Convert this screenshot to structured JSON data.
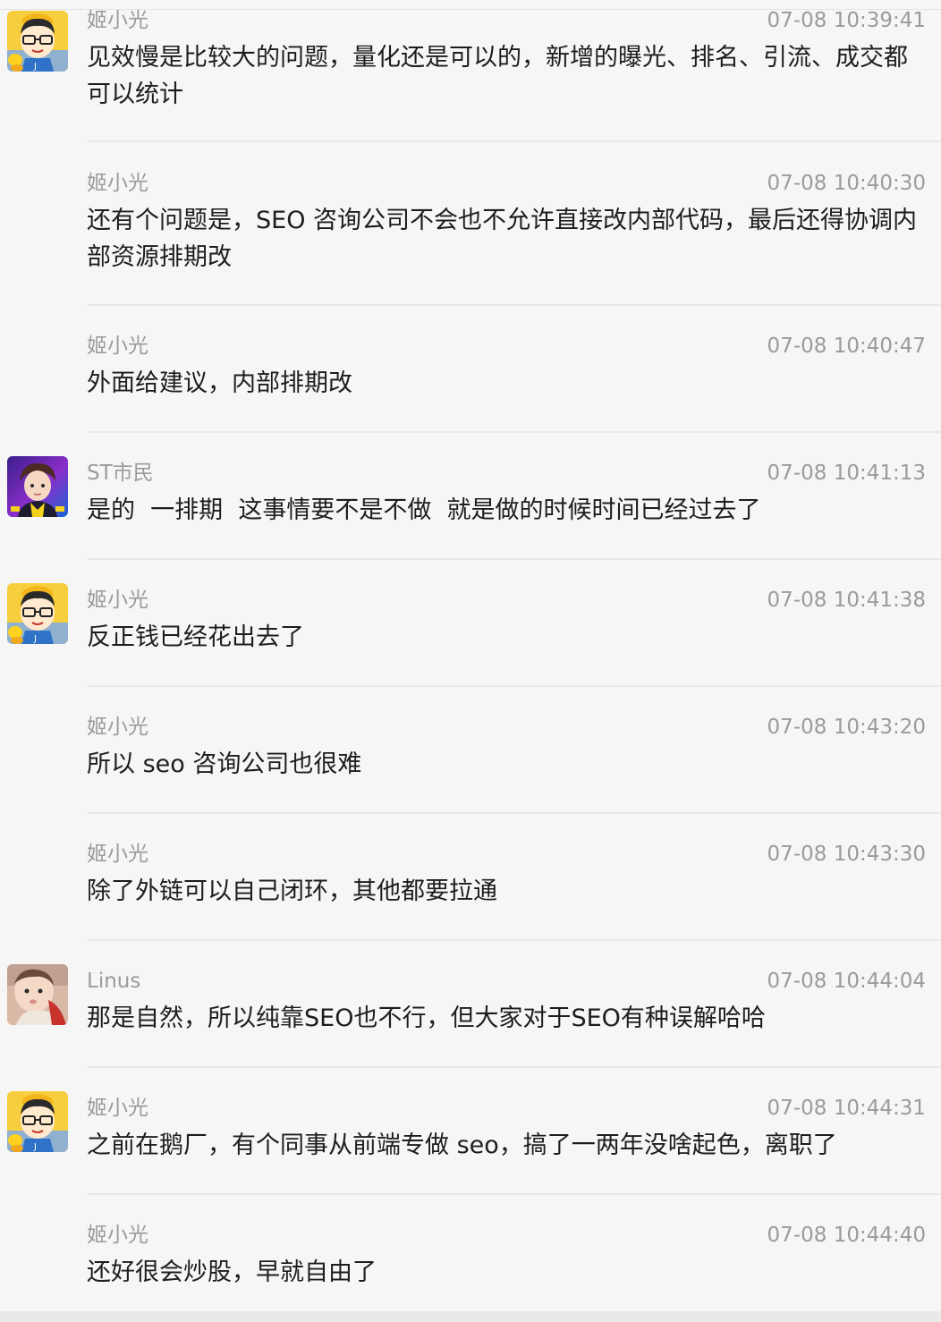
{
  "messages": [
    {
      "sender": "姬小光",
      "time": "07-08 10:39:41",
      "text": "见效慢是比较大的问题，量化还是可以的，新增的曝光、排名、引流、成交都可以统计",
      "avatar": "cartoon-glasses-avatar"
    },
    {
      "sender": "姬小光",
      "time": "07-08 10:40:30",
      "text": "还有个问题是，SEO 咨询公司不会也不允许直接改内部代码，最后还得协调内部资源排期改"
    },
    {
      "sender": "姬小光",
      "time": "07-08 10:40:47",
      "text": "外面给建议，内部排期改"
    },
    {
      "sender": "ST市民",
      "time": "07-08 10:41:13",
      "text": "是的  一排期  这事情要不是不做  就是做的时候时间已经过去了",
      "avatar": "anime-boy-avatar"
    },
    {
      "sender": "姬小光",
      "time": "07-08 10:41:38",
      "text": "反正钱已经花出去了",
      "avatar": "cartoon-glasses-avatar"
    },
    {
      "sender": "姬小光",
      "time": "07-08 10:43:20",
      "text": "所以 seo 咨询公司也很难"
    },
    {
      "sender": "姬小光",
      "time": "07-08 10:43:30",
      "text": "除了外链可以自己闭环，其他都要拉通"
    },
    {
      "sender": "Linus",
      "time": "07-08 10:44:04",
      "text": "那是自然，所以纯靠SEO也不行，但大家对于SEO有种误解哈哈",
      "avatar": "baby-photo-avatar"
    },
    {
      "sender": "姬小光",
      "time": "07-08 10:44:31",
      "text": "之前在鹅厂，有个同事从前端专做 seo，搞了一两年没啥起色，离职了",
      "avatar": "cartoon-glasses-avatar"
    },
    {
      "sender": "姬小光",
      "time": "07-08 10:44:40",
      "text": "还好很会炒股，早就自由了"
    }
  ]
}
